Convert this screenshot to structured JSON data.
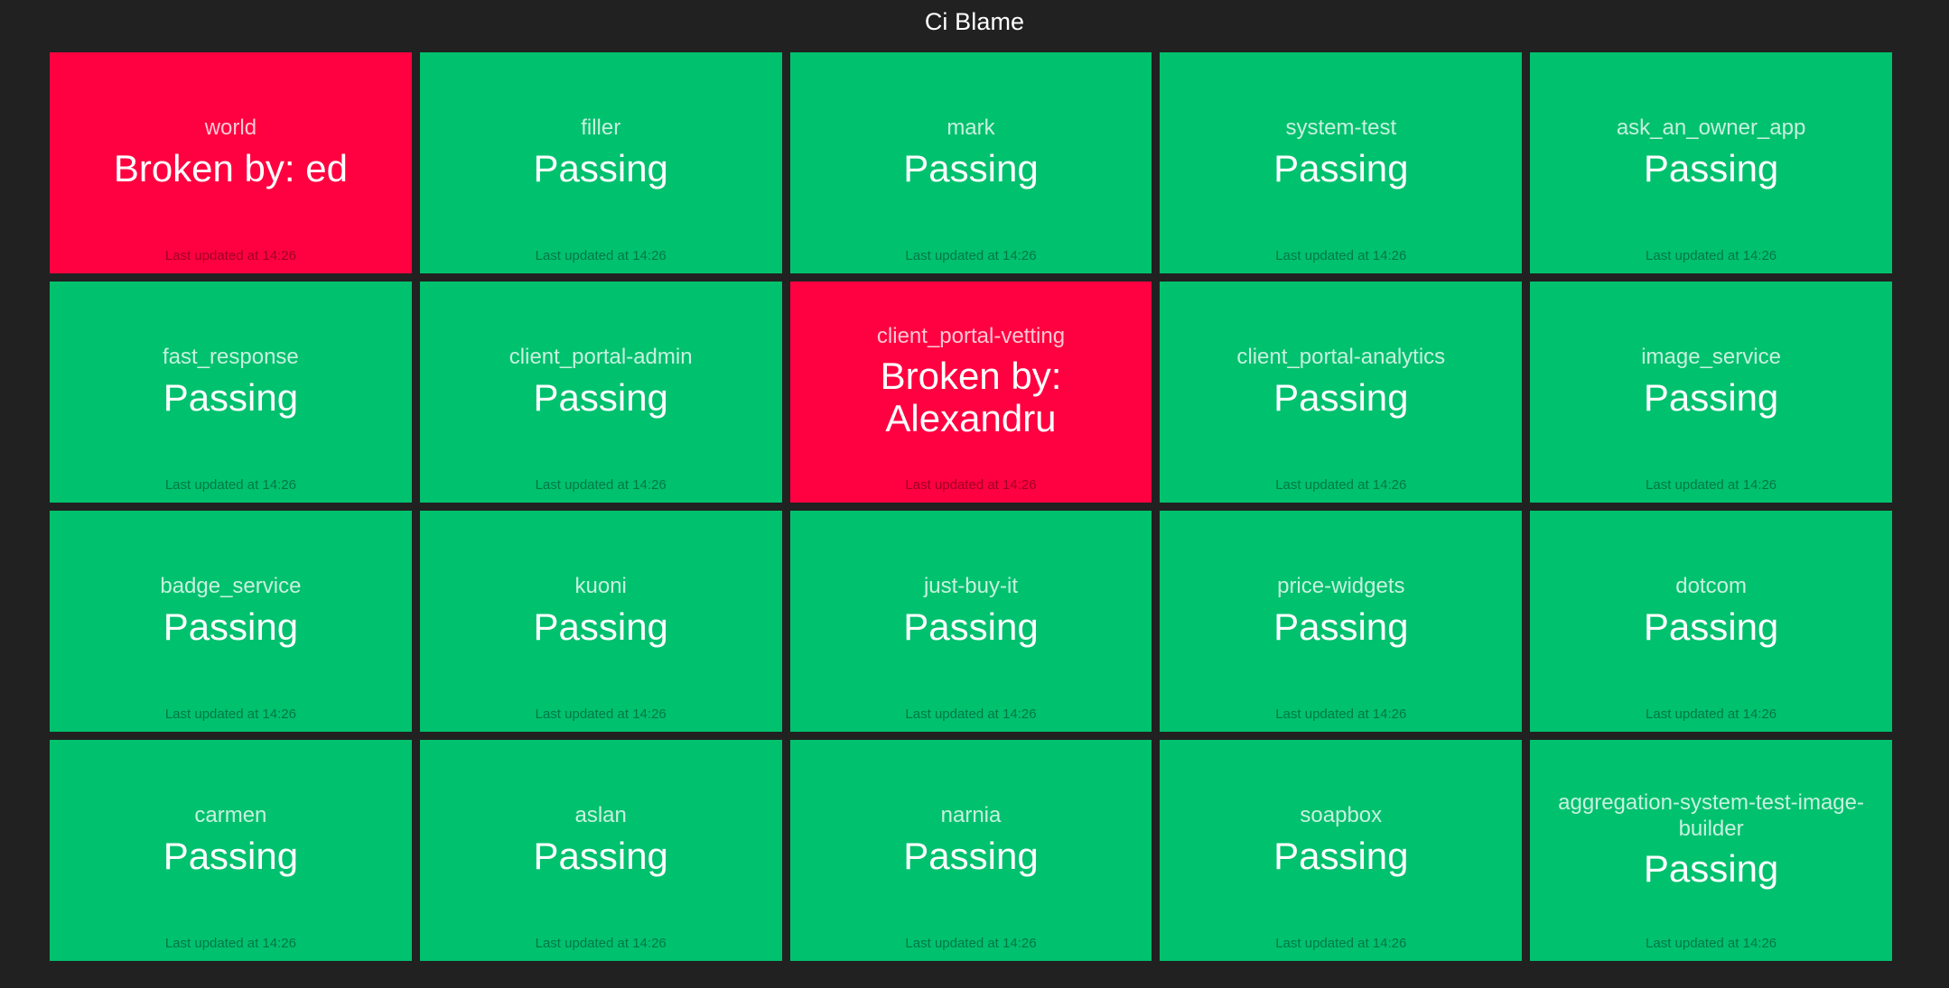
{
  "header": {
    "title": "Ci Blame"
  },
  "colors": {
    "background": "#212121",
    "passing": "#00c16e",
    "broken": "#ff0040",
    "status_text": "#ffffff"
  },
  "grid": {
    "columns": 5,
    "rows": 4
  },
  "tiles": [
    {
      "name": "world",
      "status": "Broken by: ed",
      "state": "broken",
      "updated": "Last updated at 14:26"
    },
    {
      "name": "filler",
      "status": "Passing",
      "state": "passing",
      "updated": "Last updated at 14:26"
    },
    {
      "name": "mark",
      "status": "Passing",
      "state": "passing",
      "updated": "Last updated at 14:26"
    },
    {
      "name": "system-test",
      "status": "Passing",
      "state": "passing",
      "updated": "Last updated at 14:26"
    },
    {
      "name": "ask_an_owner_app",
      "status": "Passing",
      "state": "passing",
      "updated": "Last updated at 14:26"
    },
    {
      "name": "fast_response",
      "status": "Passing",
      "state": "passing",
      "updated": "Last updated at 14:26"
    },
    {
      "name": "client_portal-admin",
      "status": "Passing",
      "state": "passing",
      "updated": "Last updated at 14:26"
    },
    {
      "name": "client_portal-vetting",
      "status": "Broken by: Alexandru",
      "state": "broken",
      "updated": "Last updated at 14:26"
    },
    {
      "name": "client_portal-analytics",
      "status": "Passing",
      "state": "passing",
      "updated": "Last updated at 14:26"
    },
    {
      "name": "image_service",
      "status": "Passing",
      "state": "passing",
      "updated": "Last updated at 14:26"
    },
    {
      "name": "badge_service",
      "status": "Passing",
      "state": "passing",
      "updated": "Last updated at 14:26"
    },
    {
      "name": "kuoni",
      "status": "Passing",
      "state": "passing",
      "updated": "Last updated at 14:26"
    },
    {
      "name": "just-buy-it",
      "status": "Passing",
      "state": "passing",
      "updated": "Last updated at 14:26"
    },
    {
      "name": "price-widgets",
      "status": "Passing",
      "state": "passing",
      "updated": "Last updated at 14:26"
    },
    {
      "name": "dotcom",
      "status": "Passing",
      "state": "passing",
      "updated": "Last updated at 14:26"
    },
    {
      "name": "carmen",
      "status": "Passing",
      "state": "passing",
      "updated": "Last updated at 14:26"
    },
    {
      "name": "aslan",
      "status": "Passing",
      "state": "passing",
      "updated": "Last updated at 14:26"
    },
    {
      "name": "narnia",
      "status": "Passing",
      "state": "passing",
      "updated": "Last updated at 14:26"
    },
    {
      "name": "soapbox",
      "status": "Passing",
      "state": "passing",
      "updated": "Last updated at 14:26"
    },
    {
      "name": "aggregation-system-test-image-builder",
      "status": "Passing",
      "state": "passing",
      "updated": "Last updated at 14:26"
    }
  ]
}
